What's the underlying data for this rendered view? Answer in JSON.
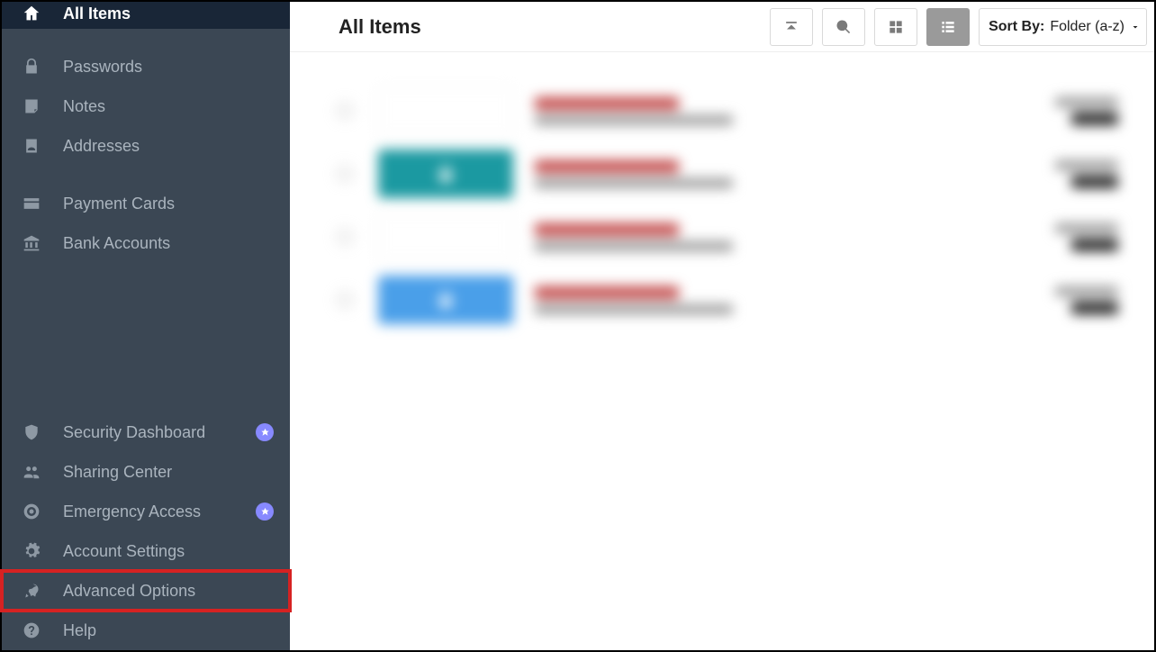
{
  "sidebar": {
    "top": [
      {
        "id": "all-items",
        "label": "All Items",
        "icon": "home",
        "active": true
      },
      {
        "id": "passwords",
        "label": "Passwords",
        "icon": "lock"
      },
      {
        "id": "notes",
        "label": "Notes",
        "icon": "note"
      },
      {
        "id": "addresses",
        "label": "Addresses",
        "icon": "address"
      }
    ],
    "mid": [
      {
        "id": "payment-cards",
        "label": "Payment Cards",
        "icon": "card"
      },
      {
        "id": "bank-accounts",
        "label": "Bank Accounts",
        "icon": "bank"
      }
    ],
    "bottom": [
      {
        "id": "security-dashboard",
        "label": "Security Dashboard",
        "icon": "shield",
        "badge": true
      },
      {
        "id": "sharing-center",
        "label": "Sharing Center",
        "icon": "people"
      },
      {
        "id": "emergency-access",
        "label": "Emergency Access",
        "icon": "lifebuoy",
        "badge": true
      },
      {
        "id": "account-settings",
        "label": "Account Settings",
        "icon": "gear"
      },
      {
        "id": "advanced-options",
        "label": "Advanced Options",
        "icon": "rocket",
        "highlight": true
      },
      {
        "id": "help",
        "label": "Help",
        "icon": "question"
      }
    ]
  },
  "header": {
    "title": "All Items",
    "sort_label": "Sort By:",
    "sort_value": "Folder (a-z)"
  },
  "items_blurred_count": 4
}
